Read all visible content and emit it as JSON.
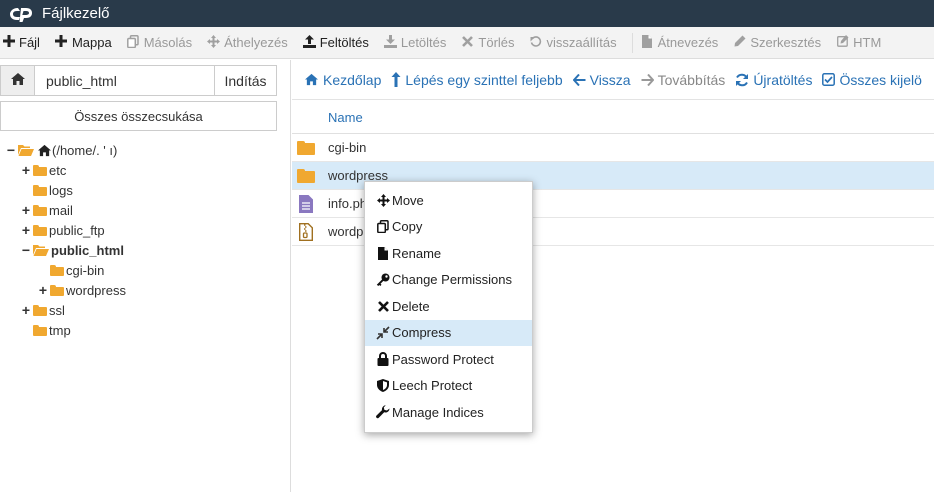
{
  "app": {
    "title": "Fájlkezelő"
  },
  "toolbar": {
    "items": [
      {
        "label": "Fájl",
        "icon": "plus-icon",
        "enabled": true
      },
      {
        "label": "Mappa",
        "icon": "plus-icon",
        "enabled": true
      },
      {
        "label": "Másolás",
        "icon": "copy-icon",
        "enabled": false
      },
      {
        "label": "Áthelyezés",
        "icon": "move-icon",
        "enabled": false
      },
      {
        "label": "Feltöltés",
        "icon": "upload-icon",
        "enabled": true
      },
      {
        "label": "Letöltés",
        "icon": "download-icon",
        "enabled": false
      },
      {
        "label": "Törlés",
        "icon": "times-icon",
        "enabled": false
      },
      {
        "label": "visszaállítás",
        "icon": "undo-icon",
        "enabled": false
      },
      {
        "label": "Átnevezés",
        "icon": "file-icon",
        "enabled": false
      },
      {
        "label": "Szerkesztés",
        "icon": "pencil-icon",
        "enabled": false
      },
      {
        "label": "HTM",
        "icon": "pencil-square-icon",
        "enabled": false
      }
    ]
  },
  "left": {
    "path_value": "public_html",
    "go_label": "Indítás",
    "collapse_label": "Összes összecsukása",
    "tree": [
      {
        "label": "(/home/.  '   ı)",
        "toggle": "−",
        "level": 0,
        "home": true,
        "open": true
      },
      {
        "label": "etc",
        "toggle": "+",
        "level": 1
      },
      {
        "label": "logs",
        "toggle": "",
        "level": 1
      },
      {
        "label": "mail",
        "toggle": "+",
        "level": 1
      },
      {
        "label": "public_ftp",
        "toggle": "+",
        "level": 1
      },
      {
        "label": "public_html",
        "toggle": "−",
        "level": 1,
        "bold": true,
        "open": true
      },
      {
        "label": "cgi-bin",
        "toggle": "",
        "level": 2
      },
      {
        "label": "wordpress",
        "toggle": "+",
        "level": 2
      },
      {
        "label": "ssl",
        "toggle": "+",
        "level": 1
      },
      {
        "label": "tmp",
        "toggle": "",
        "level": 1
      }
    ]
  },
  "nav": {
    "items": [
      {
        "label": "Kezdőlap",
        "icon": "home-icon",
        "enabled": true
      },
      {
        "label": "Lépés egy szinttel feljebb",
        "icon": "level-up-icon",
        "enabled": true
      },
      {
        "label": "Vissza",
        "icon": "arrow-left-icon",
        "enabled": true
      },
      {
        "label": "Továbbítás",
        "icon": "arrow-right-icon",
        "enabled": false
      },
      {
        "label": "Újratöltés",
        "icon": "refresh-icon",
        "enabled": true
      },
      {
        "label": "Összes kijelö",
        "icon": "check-square-icon",
        "enabled": true
      }
    ]
  },
  "table": {
    "column_name": "Name",
    "rows": [
      {
        "name": "cgi-bin",
        "type": "folder",
        "selected": false
      },
      {
        "name": "wordpress",
        "type": "folder",
        "selected": true
      },
      {
        "name": "info.ph",
        "type": "file-text",
        "selected": false
      },
      {
        "name": "wordp",
        "type": "file-archive",
        "selected": false
      }
    ]
  },
  "context_menu": {
    "items": [
      {
        "label": "Move",
        "icon": "move-icon",
        "highlighted": false
      },
      {
        "label": "Copy",
        "icon": "copy-icon",
        "highlighted": false
      },
      {
        "label": "Rename",
        "icon": "file-icon",
        "highlighted": false
      },
      {
        "label": "Change Permissions",
        "icon": "key-icon",
        "highlighted": false
      },
      {
        "label": "Delete",
        "icon": "times-icon",
        "highlighted": false
      },
      {
        "label": "Compress",
        "icon": "compress-icon",
        "highlighted": true
      },
      {
        "label": "Password Protect",
        "icon": "lock-icon",
        "highlighted": false
      },
      {
        "label": "Leech Protect",
        "icon": "shield-icon",
        "highlighted": false
      },
      {
        "label": "Manage Indices",
        "icon": "wrench-icon",
        "highlighted": false
      }
    ]
  },
  "colors": {
    "titlebar": "#293a4a",
    "link": "#2a72b5",
    "folder": "#f0a830",
    "selected_row": "#d7eaf8",
    "file_text": "#8a78c0",
    "file_archive": "#a07020"
  }
}
